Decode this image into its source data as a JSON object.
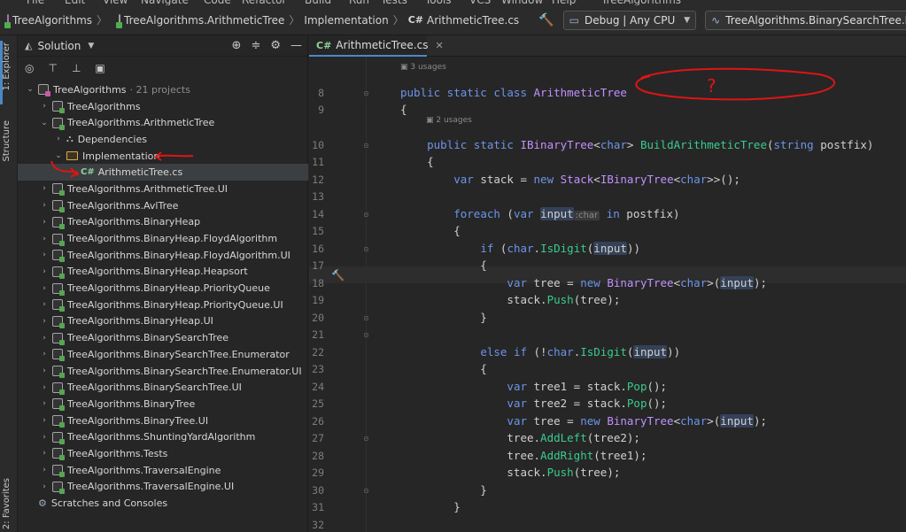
{
  "menu": [
    "File",
    "Edit",
    "View",
    "Navigate",
    "Code",
    "Refactor",
    "Build",
    "Run",
    "Tests",
    "Tools",
    "VCS",
    "Window",
    "Help",
    "TreeAlgorithms"
  ],
  "breadcrumbs": {
    "solution": "TreeAlgorithms",
    "project": "TreeAlgorithms.ArithmeticTree",
    "folder": "Implementation",
    "file": "ArithmeticTree.cs",
    "cs_badge": "C#"
  },
  "toolbar": {
    "config": "Debug | Any CPU",
    "run_target": "TreeAlgorithms.BinarySearchTree.Enumerator"
  },
  "side_tabs": {
    "explorer": "1: Explorer",
    "structure": "Structure",
    "favorites": "2: Favorites"
  },
  "solution_panel": {
    "title": "Solution",
    "root": {
      "name": "TreeAlgorithms",
      "meta": "· 21 projects"
    },
    "items": [
      {
        "label": "TreeAlgorithms",
        "kind": "project",
        "depth": 1,
        "arrow": "›"
      },
      {
        "label": "TreeAlgorithms.ArithmeticTree",
        "kind": "project",
        "depth": 1,
        "arrow": "⌄"
      },
      {
        "label": "Dependencies",
        "kind": "deps",
        "depth": 2,
        "arrow": "›"
      },
      {
        "label": "Implementation",
        "kind": "folder",
        "depth": 2,
        "arrow": "⌄"
      },
      {
        "label": "ArithmeticTree.cs",
        "kind": "file",
        "depth": 3,
        "arrow": ""
      },
      {
        "label": "TreeAlgorithms.ArithmeticTree.UI",
        "kind": "project",
        "depth": 1,
        "arrow": "›"
      },
      {
        "label": "TreeAlgorithms.AvlTree",
        "kind": "project",
        "depth": 1,
        "arrow": "›"
      },
      {
        "label": "TreeAlgorithms.BinaryHeap",
        "kind": "project",
        "depth": 1,
        "arrow": "›"
      },
      {
        "label": "TreeAlgorithms.BinaryHeap.FloydAlgorithm",
        "kind": "project",
        "depth": 1,
        "arrow": "›"
      },
      {
        "label": "TreeAlgorithms.BinaryHeap.FloydAlgorithm.UI",
        "kind": "project",
        "depth": 1,
        "arrow": "›"
      },
      {
        "label": "TreeAlgorithms.BinaryHeap.Heapsort",
        "kind": "project",
        "depth": 1,
        "arrow": "›"
      },
      {
        "label": "TreeAlgorithms.BinaryHeap.PriorityQueue",
        "kind": "project",
        "depth": 1,
        "arrow": "›"
      },
      {
        "label": "TreeAlgorithms.BinaryHeap.PriorityQueue.UI",
        "kind": "project",
        "depth": 1,
        "arrow": "›"
      },
      {
        "label": "TreeAlgorithms.BinaryHeap.UI",
        "kind": "project",
        "depth": 1,
        "arrow": "›"
      },
      {
        "label": "TreeAlgorithms.BinarySearchTree",
        "kind": "project",
        "depth": 1,
        "arrow": "›"
      },
      {
        "label": "TreeAlgorithms.BinarySearchTree.Enumerator",
        "kind": "project",
        "depth": 1,
        "arrow": "›"
      },
      {
        "label": "TreeAlgorithms.BinarySearchTree.Enumerator.UI",
        "kind": "project",
        "depth": 1,
        "arrow": "›"
      },
      {
        "label": "TreeAlgorithms.BinarySearchTree.UI",
        "kind": "project",
        "depth": 1,
        "arrow": "›"
      },
      {
        "label": "TreeAlgorithms.BinaryTree",
        "kind": "project",
        "depth": 1,
        "arrow": "›"
      },
      {
        "label": "TreeAlgorithms.BinaryTree.UI",
        "kind": "project",
        "depth": 1,
        "arrow": "›"
      },
      {
        "label": "TreeAlgorithms.ShuntingYardAlgorithm",
        "kind": "project",
        "depth": 1,
        "arrow": "›"
      },
      {
        "label": "TreeAlgorithms.Tests",
        "kind": "project",
        "depth": 1,
        "arrow": "›"
      },
      {
        "label": "TreeAlgorithms.TraversalEngine",
        "kind": "project",
        "depth": 1,
        "arrow": "›"
      },
      {
        "label": "TreeAlgorithms.TraversalEngine.UI",
        "kind": "project",
        "depth": 1,
        "arrow": "›"
      },
      {
        "label": "Scratches and Consoles",
        "kind": "scratch",
        "depth": 0,
        "arrow": ""
      }
    ]
  },
  "editor": {
    "tab_label": "ArithmeticTree.cs",
    "tab_badge": "C#",
    "hint_3_usages": "3 usages",
    "hint_2_usages": "2 usages",
    "type_hint": ":char",
    "annotation": "?",
    "lines": [
      {
        "n": "8",
        "html": "<span class='kw'>public static class</span> <span class='ty'>ArithmeticTree</span>"
      },
      {
        "n": "9",
        "html": "{"
      },
      {
        "n": "10",
        "html": "    <span class='kw'>public static</span> <span class='ty'>IBinaryTree</span>&lt;<span class='kw'>char</span>&gt; <span class='mt'>BuildArithmeticTree</span>(<span class='kw'>string</span> postfix)"
      },
      {
        "n": "11",
        "html": "    {"
      },
      {
        "n": "12",
        "html": "        <span class='kw'>var</span> stack = <span class='kw'>new</span> <span class='ty'>Stack</span>&lt;<span class='ty'>IBinaryTree</span>&lt;<span class='kw'>char</span>&gt;&gt;();"
      },
      {
        "n": "13",
        "html": ""
      },
      {
        "n": "14",
        "html": "        <span class='kw'>foreach</span> (<span class='kw'>var</span> <span class='hl'>input</span><span class='ih'>:char</span> <span class='kw'>in</span> postfix)"
      },
      {
        "n": "15",
        "html": "        {"
      },
      {
        "n": "16",
        "html": "            <span class='kw'>if</span> (<span class='kw'>char</span>.<span class='mt'>IsDigit</span>(<span class='hl'>input</span>))"
      },
      {
        "n": "17",
        "html": "            {"
      },
      {
        "n": "18",
        "html": "                <span class='kw'>var</span> tree = <span class='kw'>new</span> <span class='ty'>BinaryTree</span>&lt;<span class='kw'>char</span>&gt;(<span class='hl'>input</span>);"
      },
      {
        "n": "19",
        "html": "                stack.<span class='mt'>Push</span>(tree);"
      },
      {
        "n": "20",
        "html": "            }"
      },
      {
        "n": "21",
        "html": ""
      },
      {
        "n": "22",
        "html": "            <span class='kw'>else if</span> (!<span class='kw'>char</span>.<span class='mt'>IsDigit</span>(<span class='hl'>input</span>))"
      },
      {
        "n": "23",
        "html": "            {"
      },
      {
        "n": "24",
        "html": "                <span class='kw'>var</span> tree1 = stack.<span class='mt'>Pop</span>();"
      },
      {
        "n": "25",
        "html": "                <span class='kw'>var</span> tree2 = stack.<span class='mt'>Pop</span>();"
      },
      {
        "n": "26",
        "html": "                <span class='kw'>var</span> tree = <span class='kw'>new</span> <span class='ty'>BinaryTree</span>&lt;<span class='kw'>char</span>&gt;(<span class='hl'>input</span>);"
      },
      {
        "n": "27",
        "html": "                tree.<span class='mt'>AddLeft</span>(tree2);"
      },
      {
        "n": "28",
        "html": "                tree.<span class='mt'>AddRight</span>(tree1);"
      },
      {
        "n": "29",
        "html": "                stack.<span class='mt'>Push</span>(tree);"
      },
      {
        "n": "30",
        "html": "            }"
      },
      {
        "n": "31",
        "html": "        }"
      },
      {
        "n": "32",
        "html": ""
      }
    ]
  }
}
